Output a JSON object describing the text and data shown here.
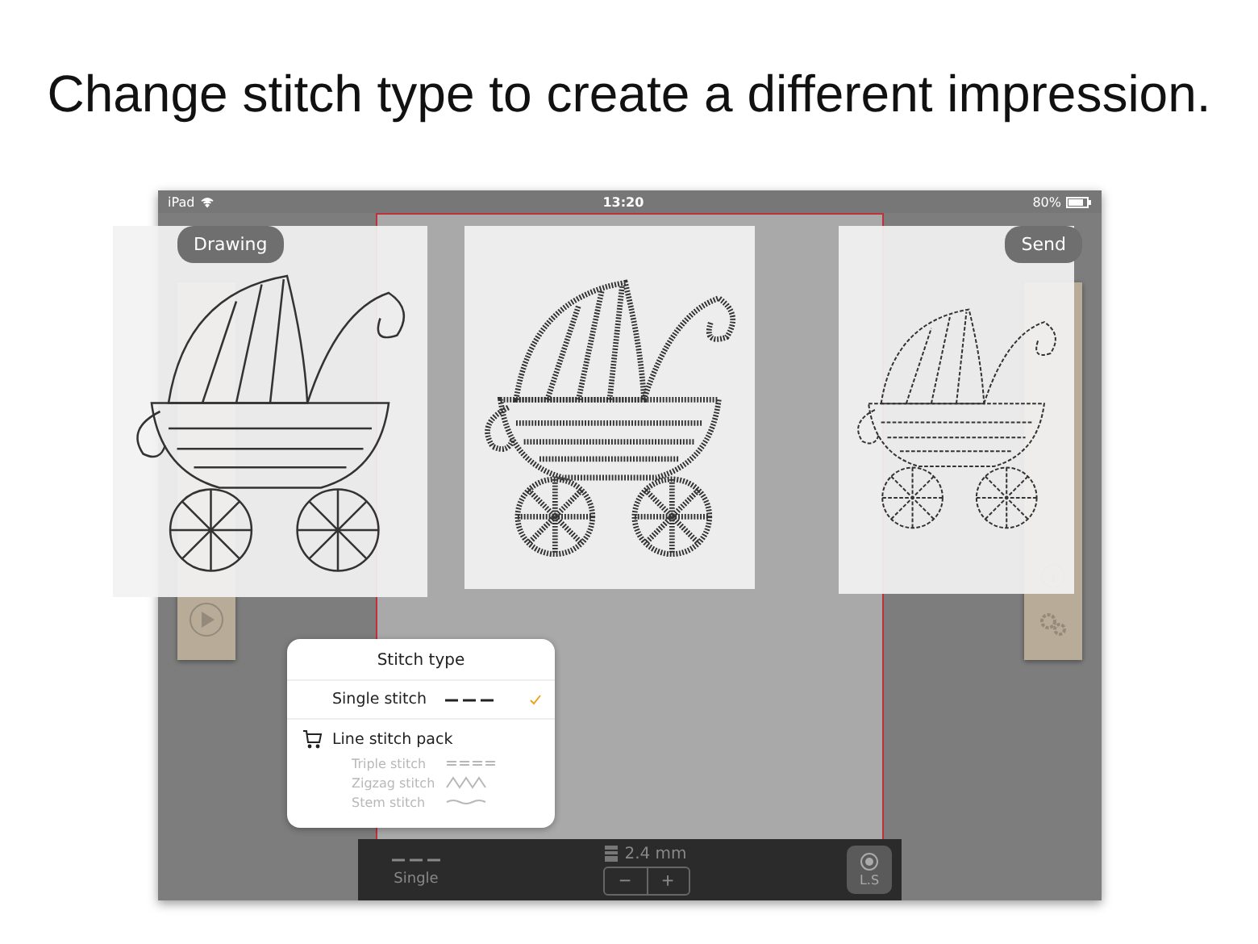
{
  "headline": "Change stitch type to create a different impression.",
  "status_bar": {
    "device": "iPad",
    "time": "13:20",
    "battery": "80%"
  },
  "toolbar": {
    "left_button": "Drawing",
    "right_button": "Send"
  },
  "stitch_popover": {
    "title": "Stitch type",
    "options": [
      {
        "label": "Single stitch",
        "kind": "dashed",
        "selected": true
      }
    ],
    "pack": {
      "label": "Line stitch pack",
      "items": [
        {
          "label": "Triple stitch",
          "kind": "triple",
          "disabled": true
        },
        {
          "label": "Zigzag stitch",
          "kind": "zigzag",
          "disabled": true
        },
        {
          "label": "Stem stitch",
          "kind": "stem",
          "disabled": true
        }
      ]
    }
  },
  "bottom_bar": {
    "stitch_label": "Single",
    "size": "2.4 mm",
    "minus": "−",
    "plus": "+",
    "ls_button": "L.S"
  },
  "samples": [
    {
      "kind": "outline"
    },
    {
      "kind": "zigzag"
    },
    {
      "kind": "running"
    }
  ]
}
